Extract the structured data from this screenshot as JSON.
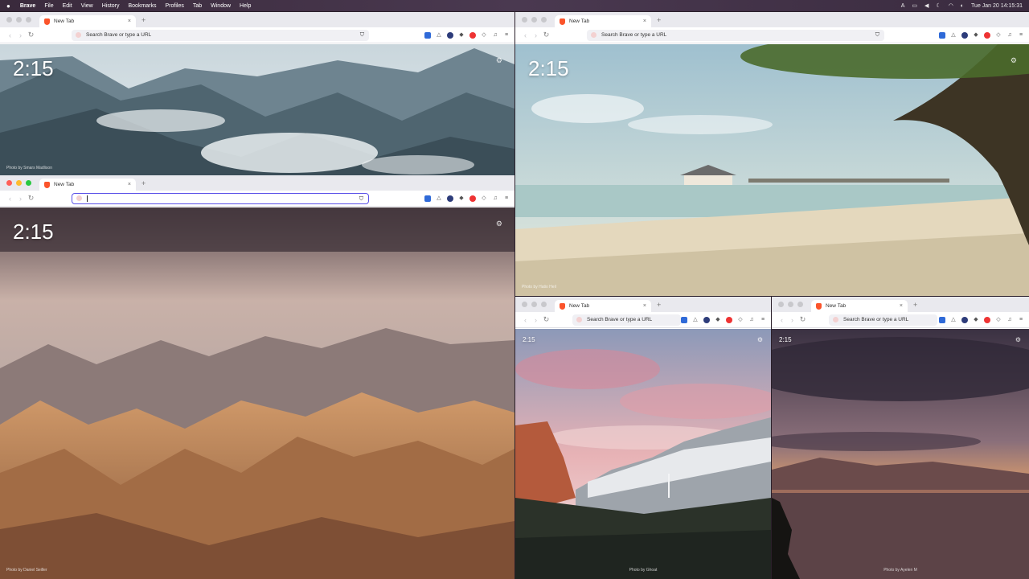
{
  "menubar": {
    "apple_icon": "apple-logo-icon",
    "items": [
      "Brave",
      "File",
      "Edit",
      "View",
      "History",
      "Bookmarks",
      "Profiles",
      "Tab",
      "Window",
      "Help"
    ],
    "input_indicator": "A",
    "clock": "Tue Jan 20  14:15:31"
  },
  "windows": [
    {
      "id": "top-left",
      "tab_title": "New Tab",
      "omnibox_placeholder": "Search Brave or type a URL",
      "clock": "2:15",
      "credit": "Photo by Smars Madlison",
      "active": false
    },
    {
      "id": "top-right",
      "tab_title": "New Tab",
      "omnibox_placeholder": "Search Brave or type a URL",
      "clock": "2:15",
      "credit": "Photo by Hatio Heil",
      "active": false
    },
    {
      "id": "main",
      "tab_title": "New Tab",
      "omnibox_value": "",
      "clock": "2:15",
      "credit": "Photo by Daniel Seiller",
      "active": true
    },
    {
      "id": "bottom-middle",
      "tab_title": "New Tab",
      "omnibox_placeholder": "Search Brave or type a URL",
      "clock": "2:15",
      "credit": "Photo by Ghoat",
      "active": false
    },
    {
      "id": "bottom-right",
      "tab_title": "New Tab",
      "omnibox_placeholder": "Search Brave or type a URL",
      "clock": "2:15",
      "credit": "Photo by Ayelen M",
      "active": false
    }
  ],
  "glyphs": {
    "tab_close": "×",
    "new_tab": "+",
    "back": "‹",
    "forward": "›",
    "reload": "↻",
    "gear": "⚙",
    "shield": "⛉",
    "menu": "≡"
  },
  "colors": {
    "brave_orange": "#fb542b",
    "focus_ring": "#5b52e8"
  }
}
